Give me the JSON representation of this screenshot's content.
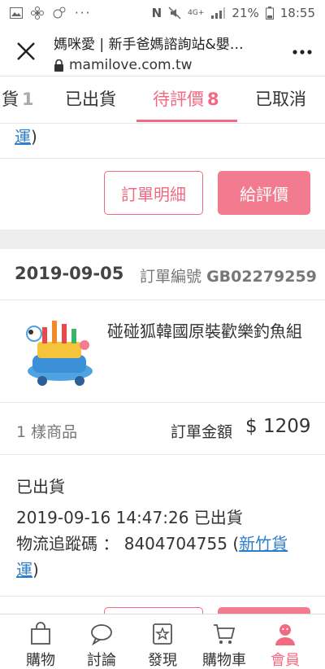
{
  "status_bar": {
    "left_icons": [
      "image-icon",
      "pinwheel-icon",
      "bubble-icon",
      "more-dots"
    ],
    "battery": "21%",
    "time": "18:55",
    "network": "4G+"
  },
  "browser": {
    "title": "媽咪愛 | 新手爸媽諮詢站&嬰…",
    "url": "mamilove.com.tw"
  },
  "tabs": [
    {
      "label": "貨",
      "count": "1"
    },
    {
      "label": "已出貨",
      "count": ""
    },
    {
      "label": "待評價",
      "count": "8"
    },
    {
      "label": "已取消",
      "count": ""
    }
  ],
  "prev_order": {
    "partial_link": "運",
    "partial_suffix": ")",
    "detail_button": "訂單明細",
    "review_button": "給評價"
  },
  "order": {
    "date": "2019-09-05",
    "order_no_label": "訂單編號",
    "order_no": "GB02279259",
    "product_name": "碰碰狐韓國原裝歡樂釣魚組",
    "item_count": "1 樣商品",
    "total_label": "訂單金額",
    "total_value": "$ 1209",
    "shipping_status": "已出貨",
    "shipping_detail": "2019-09-16 14:47:26 已出貨",
    "tracking_label": "物流追蹤碼 ： 8404704755 (",
    "carrier_link": "新竹貨運",
    "tracking_suffix": ")"
  },
  "bottom_nav": [
    {
      "label": "購物",
      "icon": "shopping-bag-icon"
    },
    {
      "label": "討論",
      "icon": "chat-bubble-icon"
    },
    {
      "label": "發現",
      "icon": "discover-star-icon"
    },
    {
      "label": "購物車",
      "icon": "cart-icon"
    },
    {
      "label": "會員",
      "icon": "member-icon"
    }
  ],
  "colors": {
    "accent": "#f06b82",
    "link": "#2d7ecb"
  }
}
